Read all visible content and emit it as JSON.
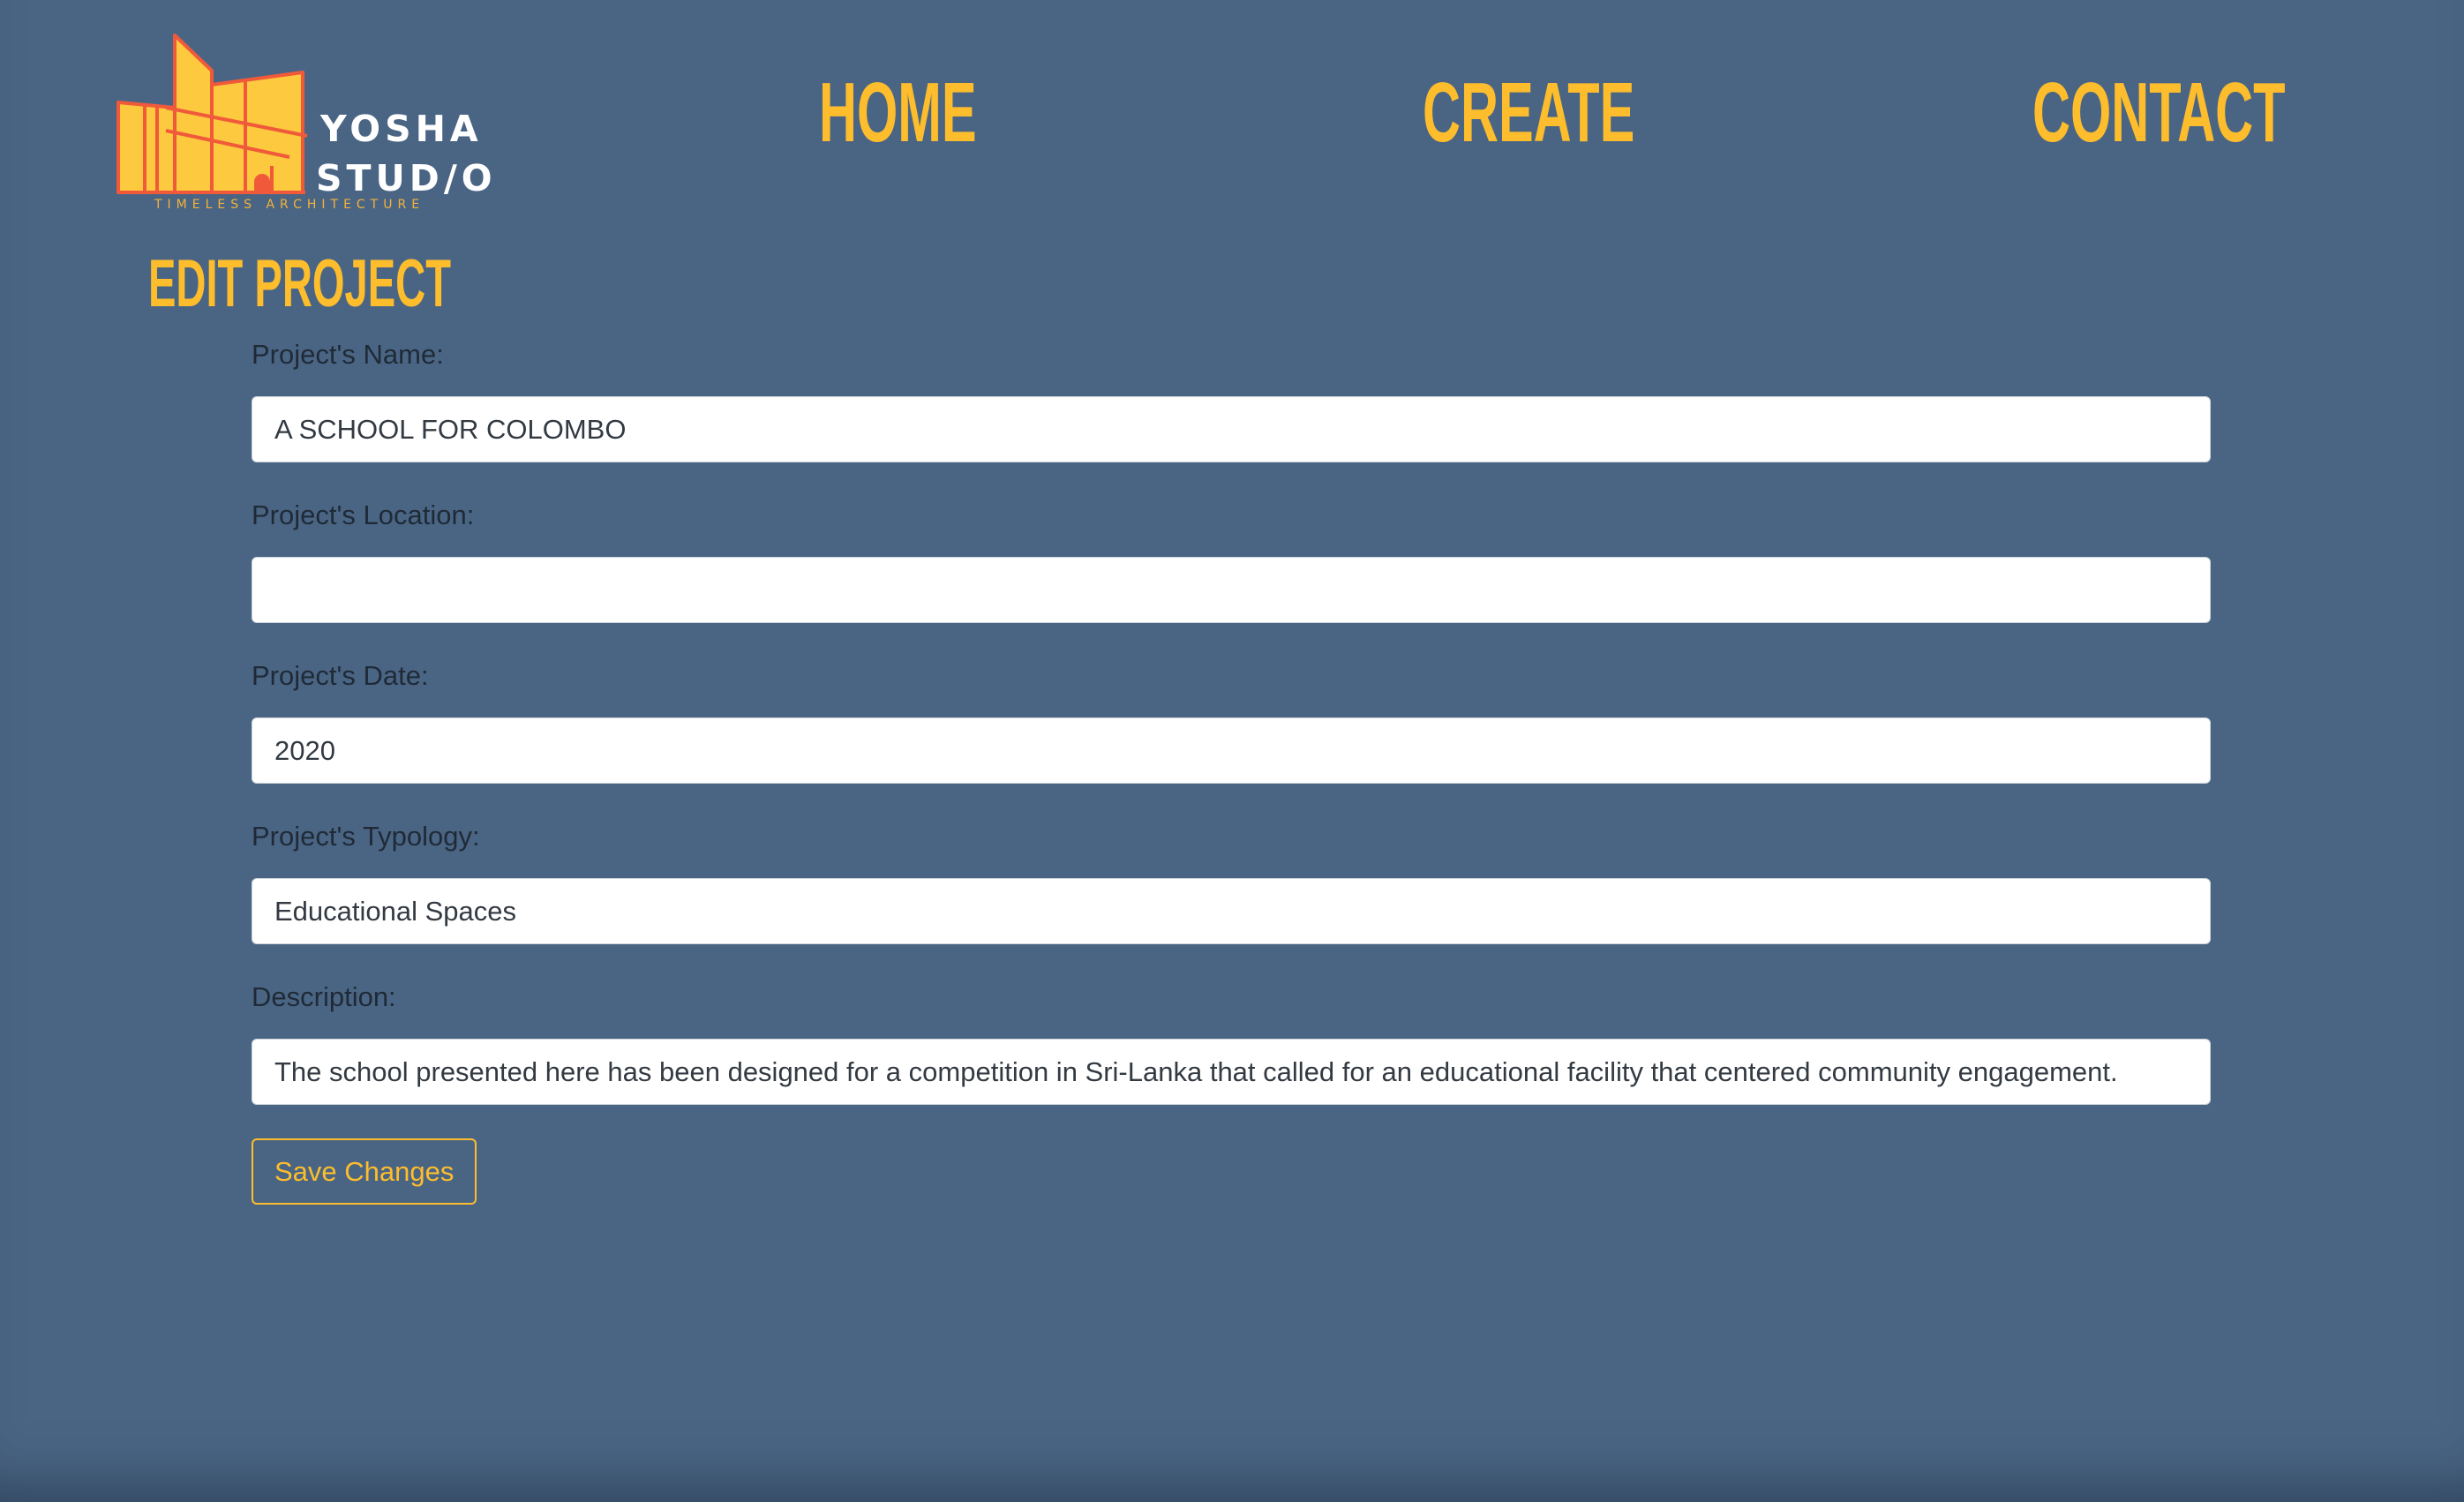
{
  "brand": {
    "line1": "YOSHA",
    "line2": "STUD/O",
    "tagline": "TIMELESS ARCHITECTURE",
    "logo_icon": "building-logo-icon",
    "colors": {
      "fill": "#fcc93f",
      "stroke": "#f05a3a"
    }
  },
  "nav": {
    "home": "HOME",
    "create": "CREATE",
    "contact": "CONTACT"
  },
  "page": {
    "title": "EDIT PROJECT"
  },
  "form": {
    "name_label": "Project's Name:",
    "name_value": "A SCHOOL FOR COLOMBO",
    "location_label": "Project's Location:",
    "location_value": "",
    "date_label": "Project's Date:",
    "date_value": "2020",
    "typology_label": "Project's Typology:",
    "typology_value": "Educational Spaces",
    "description_label": "Description:",
    "description_value": "The school presented here has been designed for a competition in Sri-Lanka that called for an educational facility that centered community engagement.",
    "save_label": "Save Changes"
  },
  "colors": {
    "background": "#4a6584",
    "accent": "#fdbd2c",
    "label_text": "#1f2a36"
  }
}
